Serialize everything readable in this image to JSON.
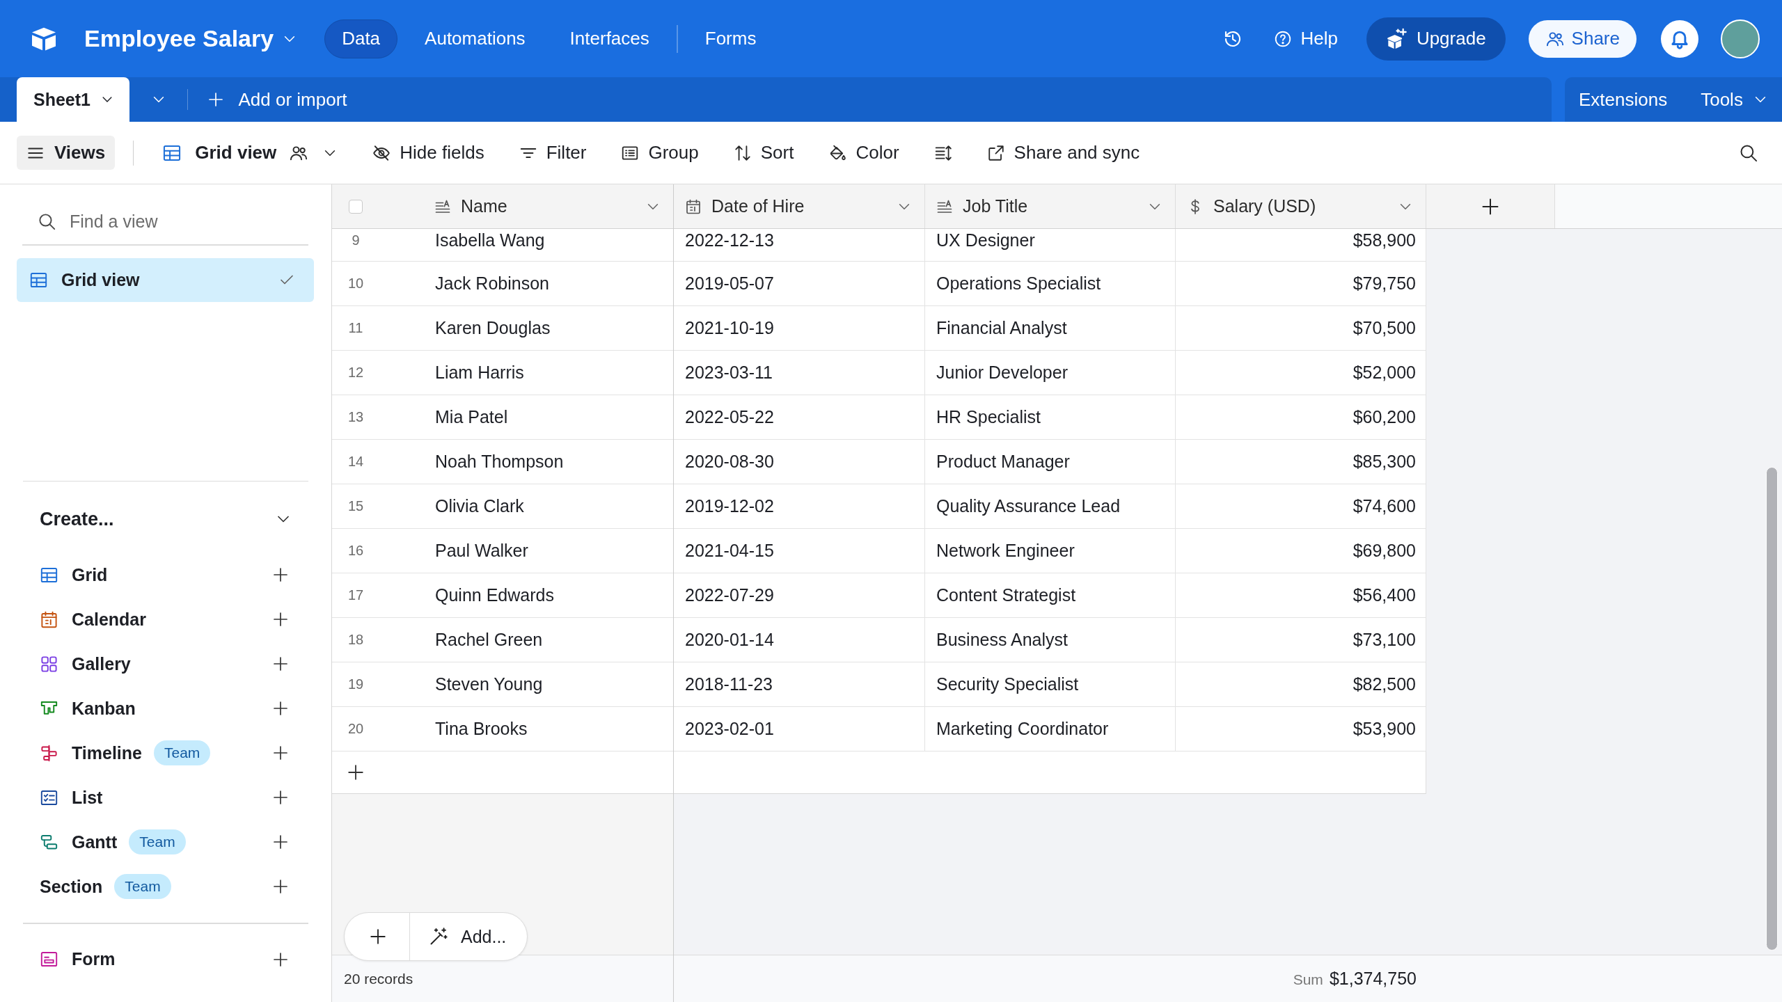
{
  "header": {
    "base_name": "Employee Salary",
    "nav": [
      {
        "label": "Data",
        "selected": true
      },
      {
        "label": "Automations",
        "selected": false
      },
      {
        "label": "Interfaces",
        "selected": false
      },
      {
        "label": "Forms",
        "selected": false
      }
    ],
    "help": "Help",
    "upgrade": "Upgrade",
    "share": "Share"
  },
  "table_tabs": {
    "tabs": [
      {
        "label": "Sheet1",
        "selected": true
      }
    ],
    "add_or_import": "Add or import",
    "extensions": "Extensions",
    "tools": "Tools"
  },
  "toolbar": {
    "views": "Views",
    "current_view": {
      "kind": "grid",
      "label": "Grid view"
    },
    "actions": [
      {
        "kind": "hide_fields",
        "label": "Hide fields"
      },
      {
        "kind": "filter",
        "label": "Filter"
      },
      {
        "kind": "group",
        "label": "Group"
      },
      {
        "kind": "sort",
        "label": "Sort"
      },
      {
        "kind": "color",
        "label": "Color"
      },
      {
        "kind": "row_height"
      },
      {
        "kind": "share",
        "label": "Share and sync"
      }
    ]
  },
  "sidebar": {
    "search": {
      "placeholder": "Find a view"
    },
    "views": [
      {
        "kind": "grid",
        "label": "Grid view",
        "selected": true
      }
    ],
    "create_heading": "Create...",
    "create_items": [
      {
        "kind": "grid",
        "label": "Grid"
      },
      {
        "kind": "calendar",
        "label": "Calendar"
      },
      {
        "kind": "gallery",
        "label": "Gallery"
      },
      {
        "kind": "kanban",
        "label": "Kanban"
      },
      {
        "kind": "timeline",
        "label": "Timeline",
        "badge": "Team"
      },
      {
        "kind": "list",
        "label": "List"
      },
      {
        "kind": "gantt",
        "label": "Gantt",
        "badge": "Team"
      },
      {
        "kind": "section",
        "label": "Section",
        "badge": "Team"
      }
    ],
    "form_items": [
      {
        "kind": "form",
        "label": "Form"
      }
    ]
  },
  "table": {
    "select_all_checked": false,
    "columns": [
      {
        "kind": "text",
        "label": "Name"
      },
      {
        "kind": "date",
        "label": "Date of Hire"
      },
      {
        "kind": "text",
        "label": "Job Title"
      },
      {
        "kind": "currency",
        "label": "Salary (USD)"
      }
    ],
    "rows": [
      {
        "number": "9",
        "cells": [
          "Isabella Wang",
          "2022-12-13",
          "UX Designer",
          "$58,900"
        ]
      },
      {
        "number": "10",
        "cells": [
          "Jack Robinson",
          "2019-05-07",
          "Operations Specialist",
          "$79,750"
        ]
      },
      {
        "number": "11",
        "cells": [
          "Karen Douglas",
          "2021-10-19",
          "Financial Analyst",
          "$70,500"
        ]
      },
      {
        "number": "12",
        "cells": [
          "Liam Harris",
          "2023-03-11",
          "Junior Developer",
          "$52,000"
        ]
      },
      {
        "number": "13",
        "cells": [
          "Mia Patel",
          "2022-05-22",
          "HR Specialist",
          "$60,200"
        ]
      },
      {
        "number": "14",
        "cells": [
          "Noah Thompson",
          "2020-08-30",
          "Product Manager",
          "$85,300"
        ]
      },
      {
        "number": "15",
        "cells": [
          "Olivia Clark",
          "2019-12-02",
          "Quality Assurance Lead",
          "$74,600"
        ]
      },
      {
        "number": "16",
        "cells": [
          "Paul Walker",
          "2021-04-15",
          "Network Engineer",
          "$69,800"
        ]
      },
      {
        "number": "17",
        "cells": [
          "Quinn Edwards",
          "2022-07-29",
          "Content Strategist",
          "$56,400"
        ]
      },
      {
        "number": "18",
        "cells": [
          "Rachel Green",
          "2020-01-14",
          "Business Analyst",
          "$73,100"
        ]
      },
      {
        "number": "19",
        "cells": [
          "Steven Young",
          "2018-11-23",
          "Security Specialist",
          "$82,500"
        ]
      },
      {
        "number": "20",
        "cells": [
          "Tina Brooks",
          "2023-02-01",
          "Marketing Coordinator",
          "$53,900"
        ]
      }
    ]
  },
  "footer": {
    "records": "20 records",
    "sum_label": "Sum",
    "sum_value": "$1,374,750"
  },
  "add_menu": {
    "label": "Add..."
  }
}
